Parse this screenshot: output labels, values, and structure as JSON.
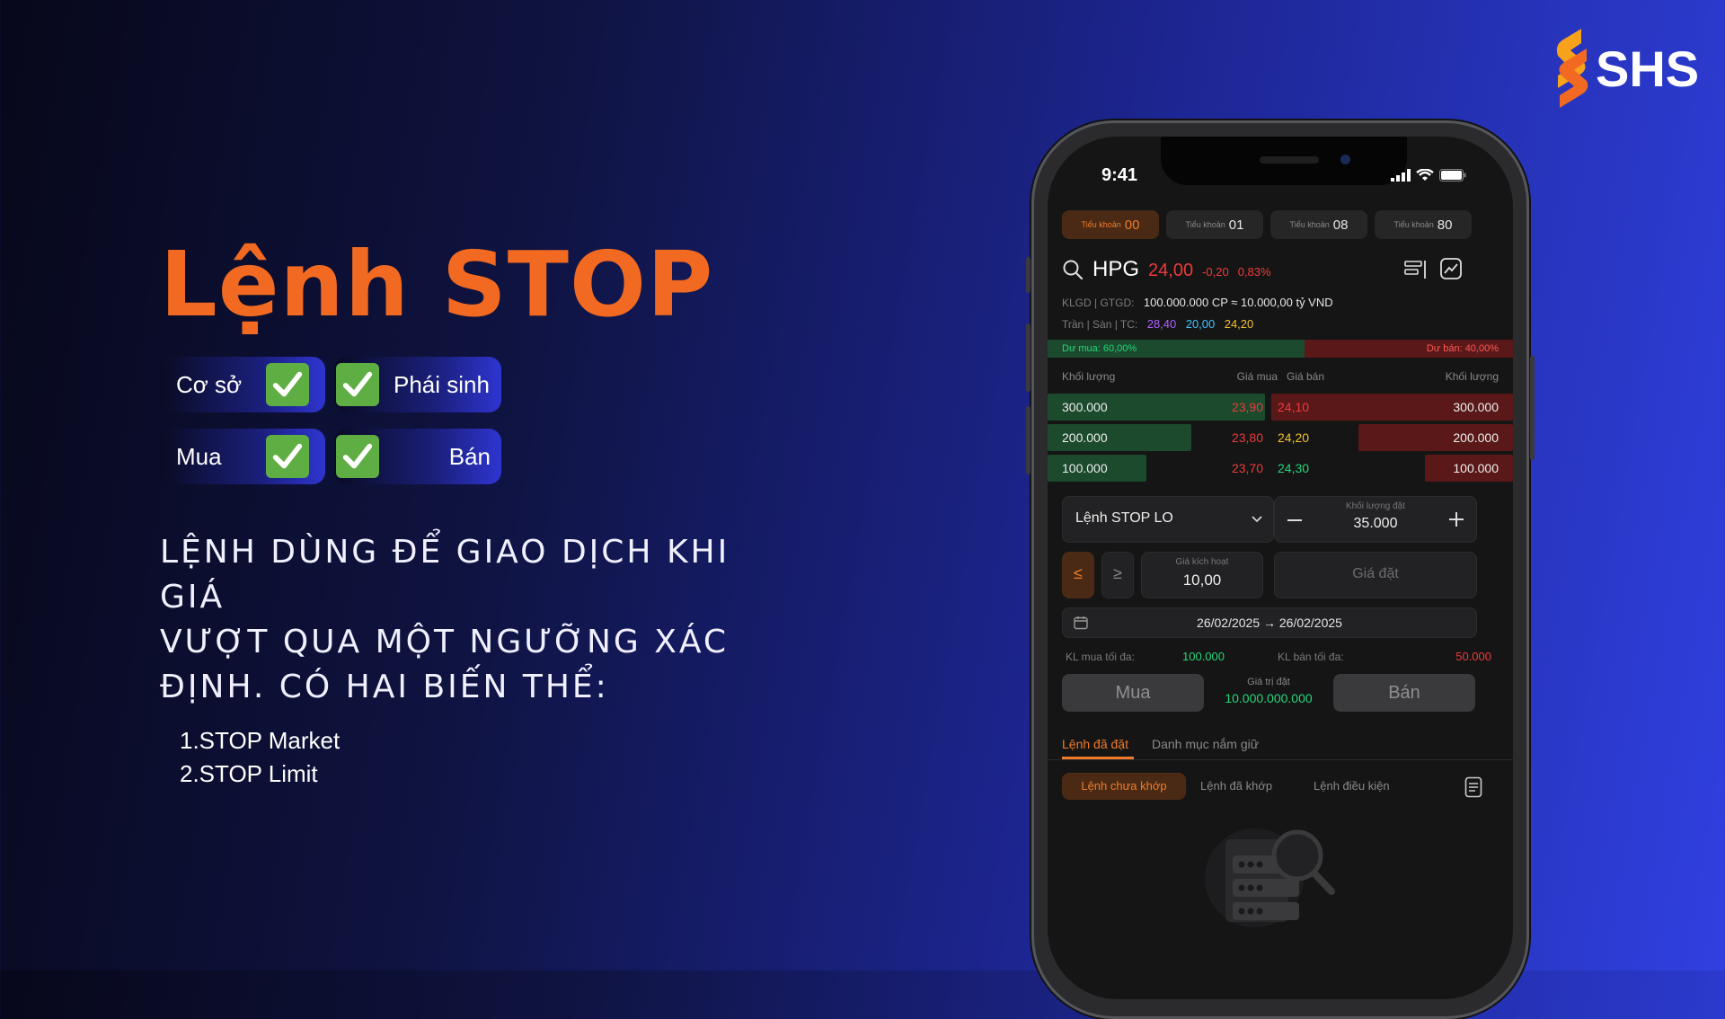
{
  "brand": {
    "name": "SHS",
    "colors": {
      "orange": "#f26a21",
      "check": "#5fae44"
    }
  },
  "hero": {
    "title": "Lệnh STOP",
    "chips": [
      {
        "left_label": "Cơ sở",
        "right_label": "Phái sinh"
      },
      {
        "left_label": "Mua",
        "right_label": "Bán"
      }
    ],
    "description_lines": [
      "LỆNH DÙNG ĐỂ GIAO DỊCH KHI GIÁ",
      "VƯỢT QUA MỘT NGƯỠNG XÁC",
      "ĐỊNH. CÓ HAI BIẾN THỂ:"
    ],
    "variants": [
      "1.STOP Market",
      "2.STOP Limit"
    ]
  },
  "phone": {
    "status": {
      "time": "9:41"
    },
    "accounts": [
      {
        "label": "Tiểu khoản",
        "num": "00",
        "active": true
      },
      {
        "label": "Tiểu khoản",
        "num": "01",
        "active": false
      },
      {
        "label": "Tiểu khoản",
        "num": "08",
        "active": false
      },
      {
        "label": "Tiểu khoản",
        "num": "80",
        "active": false
      }
    ],
    "quote": {
      "symbol": "HPG",
      "price": "24,00",
      "change": "-0,20",
      "pct": "0,83%",
      "vol_label": "KLGD | GTGD:",
      "vol_value": "100.000.000 CP ≈ 10.000,00 tỷ VND",
      "ref_label": "Trần | Sàn | TC:",
      "ceil": "28,40",
      "floor": "20,00",
      "ref": "24,20"
    },
    "ratio": {
      "buy": "Dư mua: 60,00%",
      "sell": "Dư bán: 40,00%"
    },
    "orderbook": {
      "headers": [
        "Khối lượng",
        "Giá mua",
        "Giá bán",
        "Khối lượng"
      ],
      "rows": [
        {
          "bid_vol": "300.000",
          "bid": "23,90",
          "ask": "24,10",
          "ask_vol": "300.000"
        },
        {
          "bid_vol": "200.000",
          "bid": "23,80",
          "ask": "24,20",
          "ask_vol": "200.000"
        },
        {
          "bid_vol": "100.000",
          "bid": "23,70",
          "ask": "24,30",
          "ask_vol": "100.000"
        }
      ]
    },
    "form": {
      "order_type": "Lệnh STOP LO",
      "qty_label": "Khối lượng đặt",
      "qty": "35.000",
      "le": "≤",
      "ge": "≥",
      "trigger_label": "Giá kích hoạt",
      "trigger": "10,00",
      "price_placeholder": "Giá đặt",
      "date_range": "26/02/2025 → 26/02/2025",
      "max_buy_label": "KL mua tối đa:",
      "max_buy": "100.000",
      "max_sell_label": "KL bán tối đa:",
      "max_sell": "50.000",
      "value_label": "Giá trị đặt",
      "value": "10.000.000.000",
      "buy": "Mua",
      "sell": "Bán"
    },
    "tabs": {
      "placed": "Lệnh đã đặt",
      "portfolio": "Danh mục nắm giữ"
    },
    "subtabs": {
      "pending": "Lệnh chưa khớp",
      "matched": "Lệnh đã khớp",
      "conditional": "Lệnh điều kiện"
    }
  }
}
